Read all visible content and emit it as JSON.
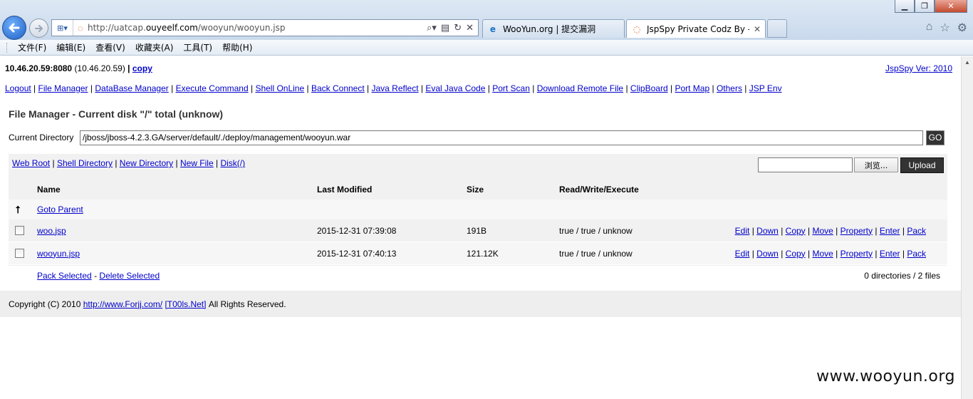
{
  "browser": {
    "back_icon": "arrow-left-icon",
    "forward_icon": "arrow-right-icon",
    "address": {
      "url_prefix": "http://uatcap.",
      "url_host": "ouyeelf.com",
      "url_suffix": "/wooyun/wooyun.jsp"
    },
    "tabs": [
      {
        "label": "WooYun.org | 提交漏洞"
      },
      {
        "label": "JspSpy Private Codz By -...",
        "close": "✕"
      }
    ],
    "menu": [
      "文件(F)",
      "编辑(E)",
      "查看(V)",
      "收藏夹(A)",
      "工具(T)",
      "帮助(H)"
    ]
  },
  "page": {
    "host": "10.46.20.59:8080",
    "host_ip": "(10.46.20.59)",
    "separator": "|",
    "copy_link": "copy",
    "version_link": "JspSpy Ver: 2010",
    "nav_links": [
      "Logout",
      "File Manager",
      "DataBase Manager",
      "Execute Command",
      "Shell OnLine",
      "Back Connect",
      "Java Reflect",
      "Eval Java Code",
      "Port Scan",
      "Download Remote File",
      "ClipBoard",
      "Port Map",
      "Others",
      "JSP Env"
    ],
    "title": "File Manager - Current disk \"/\" total (unknow)",
    "current_dir_label": "Current Directory",
    "current_dir_value": "/jboss/jboss-4.2.3.GA/server/default/./deploy/management/wooyun.war",
    "go_label": "GO",
    "tool_links": [
      "Web Root",
      "Shell Directory",
      "New Directory",
      "New File",
      "Disk(/)"
    ],
    "browse_label": "浏览...",
    "upload_label": "Upload",
    "columns": {
      "name": "Name",
      "modified": "Last Modified",
      "size": "Size",
      "rwx": "Read/Write/Execute"
    },
    "parent_link": "Goto Parent",
    "files": [
      {
        "name": "woo.jsp",
        "modified": "2015-12-31 07:39:08",
        "size": "191B",
        "rwx": "true / true / unknow"
      },
      {
        "name": "wooyun.jsp",
        "modified": "2015-12-31 07:40:13",
        "size": "121.12K",
        "rwx": "true / true / unknow"
      }
    ],
    "file_actions": [
      "Edit",
      "Down",
      "Copy",
      "Move",
      "Property",
      "Enter",
      "Pack"
    ],
    "pack_selected": "Pack Selected",
    "delete_selected": "Delete Selected",
    "dash": "-",
    "summary": "0 directories / 2 files",
    "footer": {
      "prefix": "Copyright (C) 2010",
      "link1": "http://www.Forjj.com/",
      "link2": "[T00ls.Net]",
      "suffix": "All Rights Reserved."
    }
  },
  "watermark": "www.wooyun.org"
}
